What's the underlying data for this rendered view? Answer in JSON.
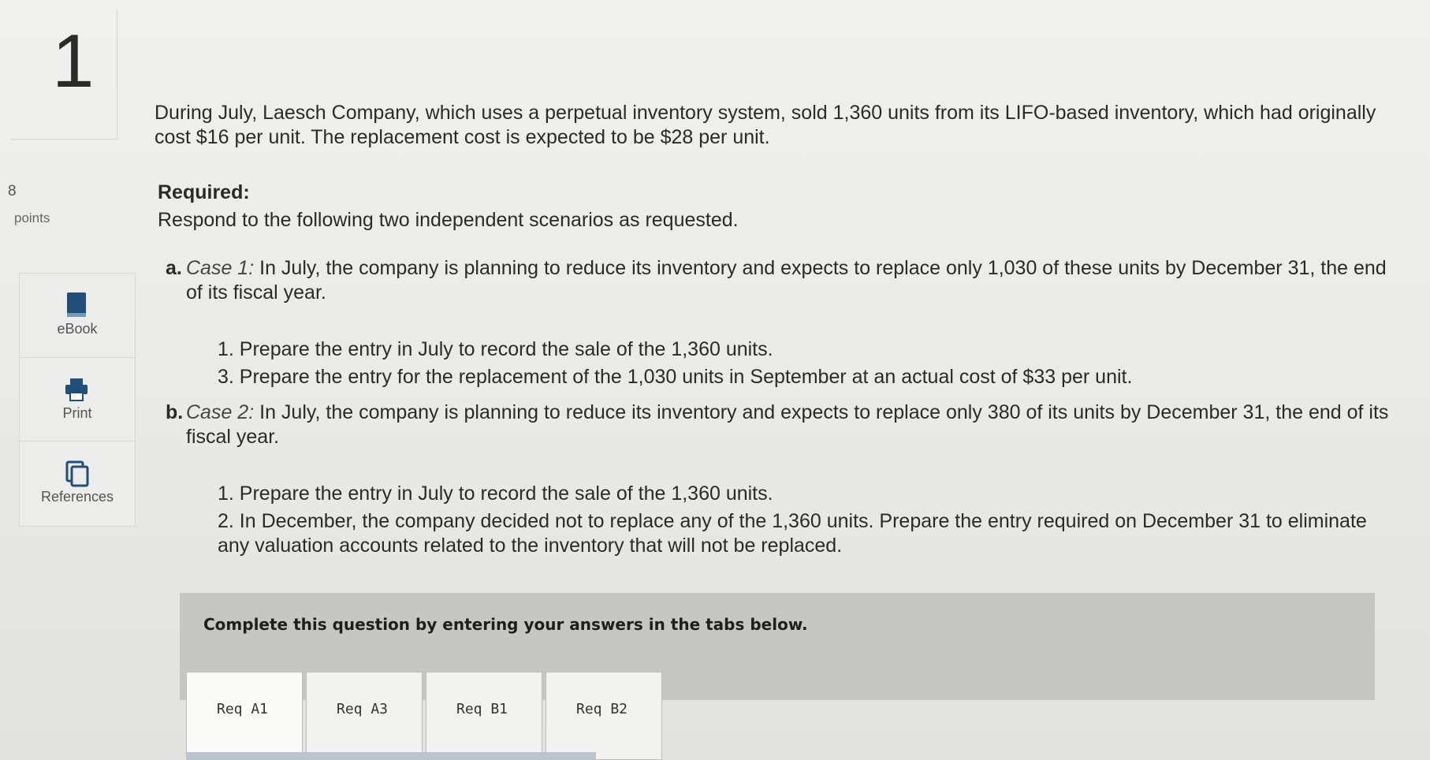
{
  "question": {
    "number": "1",
    "points_value": "8",
    "points_label": "points"
  },
  "tools": [
    {
      "label": "eBook",
      "icon": "book-icon"
    },
    {
      "label": "Print",
      "icon": "printer-icon"
    },
    {
      "label": "References",
      "icon": "references-icon"
    }
  ],
  "problem": {
    "intro": "During July, Laesch Company, which uses a perpetual inventory system, sold 1,360 units from its LIFO-based inventory, which had originally cost $16 per unit. The replacement cost is expected to be $28 per unit.",
    "required_label": "Required:",
    "required_text": "Respond to the following two independent scenarios as requested.",
    "scenario_a": {
      "letter": "a.",
      "case_name": "Case 1:",
      "text": "In July, the company is planning to reduce its inventory and expects to replace only 1,030 of these units by December 31, the end of its fiscal year.",
      "steps": [
        "1. Prepare the entry in July to record the sale of the 1,360 units.",
        "3. Prepare the entry for the replacement of the 1,030 units in September at an actual cost of $33 per unit."
      ]
    },
    "scenario_b": {
      "letter": "b.",
      "case_name": "Case 2:",
      "text": "In July, the company is planning to reduce its inventory and expects to replace only 380 of its units by December 31, the end of its fiscal year.",
      "steps": [
        "1. Prepare the entry in July to record the sale of the 1,360 units.",
        "2. In December, the company decided not to replace any of the 1,360 units. Prepare the entry required on December 31 to eliminate any valuation accounts related to the inventory that will not be replaced."
      ]
    }
  },
  "answer_panel": {
    "instruction": "Complete this question by entering your answers in the tabs below.",
    "tabs": [
      "Req A1",
      "Req A3",
      "Req B1",
      "Req B2"
    ]
  },
  "colors": {
    "panel_bg": "#c6c6c4",
    "icon_blue": "#1f4f78"
  }
}
